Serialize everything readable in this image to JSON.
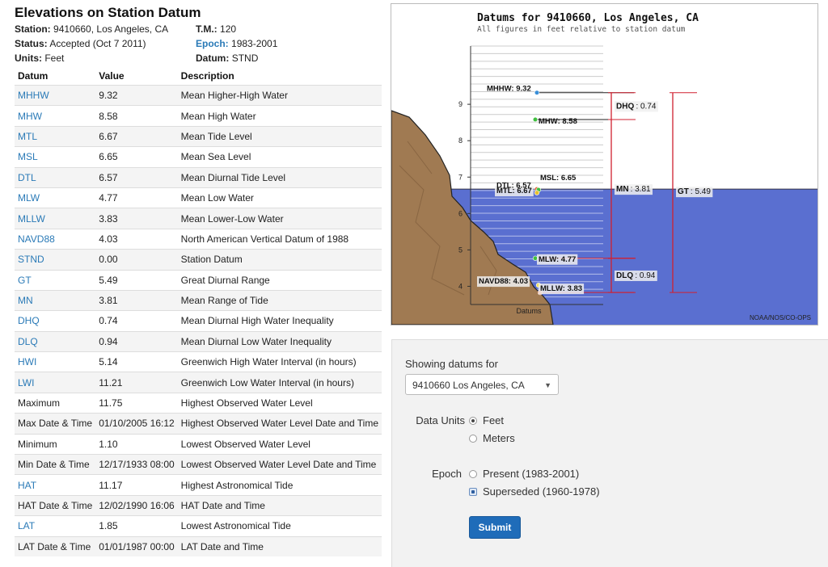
{
  "page_title": "Elevations on Station Datum",
  "meta": {
    "station_label": "Station:",
    "station_value": "9410660, Los Angeles, CA",
    "tm_label": "T.M.:",
    "tm_value": "120",
    "status_label": "Status:",
    "status_value": "Accepted (Oct 7 2011)",
    "epoch_label": "Epoch:",
    "epoch_value": "1983-2001",
    "units_label": "Units:",
    "units_value": "Feet",
    "datum_label": "Datum:",
    "datum_value": "STND"
  },
  "table": {
    "headers": [
      "Datum",
      "Value",
      "Description"
    ],
    "rows": [
      {
        "datum": "MHHW",
        "value": "9.32",
        "desc": "Mean Higher-High Water",
        "link": true
      },
      {
        "datum": "MHW",
        "value": "8.58",
        "desc": "Mean High Water",
        "link": true
      },
      {
        "datum": "MTL",
        "value": "6.67",
        "desc": "Mean Tide Level",
        "link": true
      },
      {
        "datum": "MSL",
        "value": "6.65",
        "desc": "Mean Sea Level",
        "link": true
      },
      {
        "datum": "DTL",
        "value": "6.57",
        "desc": "Mean Diurnal Tide Level",
        "link": true
      },
      {
        "datum": "MLW",
        "value": "4.77",
        "desc": "Mean Low Water",
        "link": true
      },
      {
        "datum": "MLLW",
        "value": "3.83",
        "desc": "Mean Lower-Low Water",
        "link": true
      },
      {
        "datum": "NAVD88",
        "value": "4.03",
        "desc": "North American Vertical Datum of 1988",
        "link": true
      },
      {
        "datum": "STND",
        "value": "0.00",
        "desc": "Station Datum",
        "link": true
      },
      {
        "datum": "GT",
        "value": "5.49",
        "desc": "Great Diurnal Range",
        "link": true
      },
      {
        "datum": "MN",
        "value": "3.81",
        "desc": "Mean Range of Tide",
        "link": true
      },
      {
        "datum": "DHQ",
        "value": "0.74",
        "desc": "Mean Diurnal High Water Inequality",
        "link": true
      },
      {
        "datum": "DLQ",
        "value": "0.94",
        "desc": "Mean Diurnal Low Water Inequality",
        "link": true
      },
      {
        "datum": "HWI",
        "value": "5.14",
        "desc": "Greenwich High Water Interval (in hours)",
        "link": true
      },
      {
        "datum": "LWI",
        "value": "11.21",
        "desc": "Greenwich Low Water Interval (in hours)",
        "link": true
      },
      {
        "datum": "Maximum",
        "value": "11.75",
        "desc": "Highest Observed Water Level",
        "link": false
      },
      {
        "datum": "Max Date & Time",
        "value": "01/10/2005 16:12",
        "desc": "Highest Observed Water Level Date and Time",
        "link": false
      },
      {
        "datum": "Minimum",
        "value": "1.10",
        "desc": "Lowest Observed Water Level",
        "link": false
      },
      {
        "datum": "Min Date & Time",
        "value": "12/17/1933 08:00",
        "desc": "Lowest Observed Water Level Date and Time",
        "link": false
      },
      {
        "datum": "HAT",
        "value": "11.17",
        "desc": "Highest Astronomical Tide",
        "link": true
      },
      {
        "datum": "HAT Date & Time",
        "value": "12/02/1990 16:06",
        "desc": "HAT Date and Time",
        "link": false
      },
      {
        "datum": "LAT",
        "value": "1.85",
        "desc": "Lowest Astronomical Tide",
        "link": true
      },
      {
        "datum": "LAT Date & Time",
        "value": "01/01/1987 00:00",
        "desc": "LAT Date and Time",
        "link": false
      }
    ]
  },
  "chart_data": {
    "type": "scatter",
    "title": "Datums for 9410660, Los Angeles, CA",
    "subtitle": "All figures in feet relative to station datum",
    "xlabel": "Datums",
    "ylabel": "",
    "ylim": [
      3.5,
      10.6
    ],
    "yticks": [
      4,
      5,
      6,
      7,
      8,
      9
    ],
    "credit": "NOAA/NOS/CO-OPS",
    "points": [
      {
        "name": "MHHW",
        "y": 9.32,
        "color": "#3a8fd8",
        "label": "MHHW: 9.32"
      },
      {
        "name": "MHW",
        "y": 8.58,
        "color": "#3fbf3f",
        "label": "MHW: 8.58"
      },
      {
        "name": "MTL",
        "y": 6.67,
        "color": "#e06030",
        "label": "MTL: 6.67"
      },
      {
        "name": "MSL",
        "y": 6.65,
        "color": "#3fbf3f",
        "label": "MSL: 6.65"
      },
      {
        "name": "DTL",
        "y": 6.57,
        "color": "#e8c030",
        "label": "DTL: 6.57"
      },
      {
        "name": "MLW",
        "y": 4.77,
        "color": "#3fbf3f",
        "label": "MLW: 4.77"
      },
      {
        "name": "NAVD88",
        "y": 4.03,
        "color": "#f0e060",
        "label": "NAVD88: 4.03"
      },
      {
        "name": "MLLW",
        "y": 3.83,
        "color": "#e06030",
        "label": "MLLW: 3.83"
      }
    ],
    "ranges": [
      {
        "name": "DHQ",
        "from": 8.58,
        "to": 9.32,
        "label_name": "DHQ",
        "label_value": "0.74"
      },
      {
        "name": "MN",
        "from": 4.77,
        "to": 8.58,
        "label_name": "MN",
        "label_value": "3.81"
      },
      {
        "name": "DLQ",
        "from": 3.83,
        "to": 4.77,
        "label_name": "DLQ",
        "label_value": "0.94"
      },
      {
        "name": "GT",
        "from": 3.83,
        "to": 9.32,
        "label_name": "GT",
        "label_value": "5.49"
      }
    ],
    "water_level": 6.67,
    "colors": {
      "land": "#a07a52",
      "water": "#5a6fd0",
      "range": "#d02030"
    }
  },
  "form": {
    "showing_label": "Showing datums for",
    "station_selected": "9410660 Los Angeles, CA",
    "units_label": "Data Units",
    "units_options": [
      {
        "label": "Feet",
        "checked": true
      },
      {
        "label": "Meters",
        "checked": false
      }
    ],
    "epoch_label": "Epoch",
    "epoch_options": [
      {
        "label": "Present (1983-2001)",
        "checked": false
      },
      {
        "label": "Superseded (1960-1978)",
        "checked": true
      }
    ],
    "submit_label": "Submit"
  }
}
